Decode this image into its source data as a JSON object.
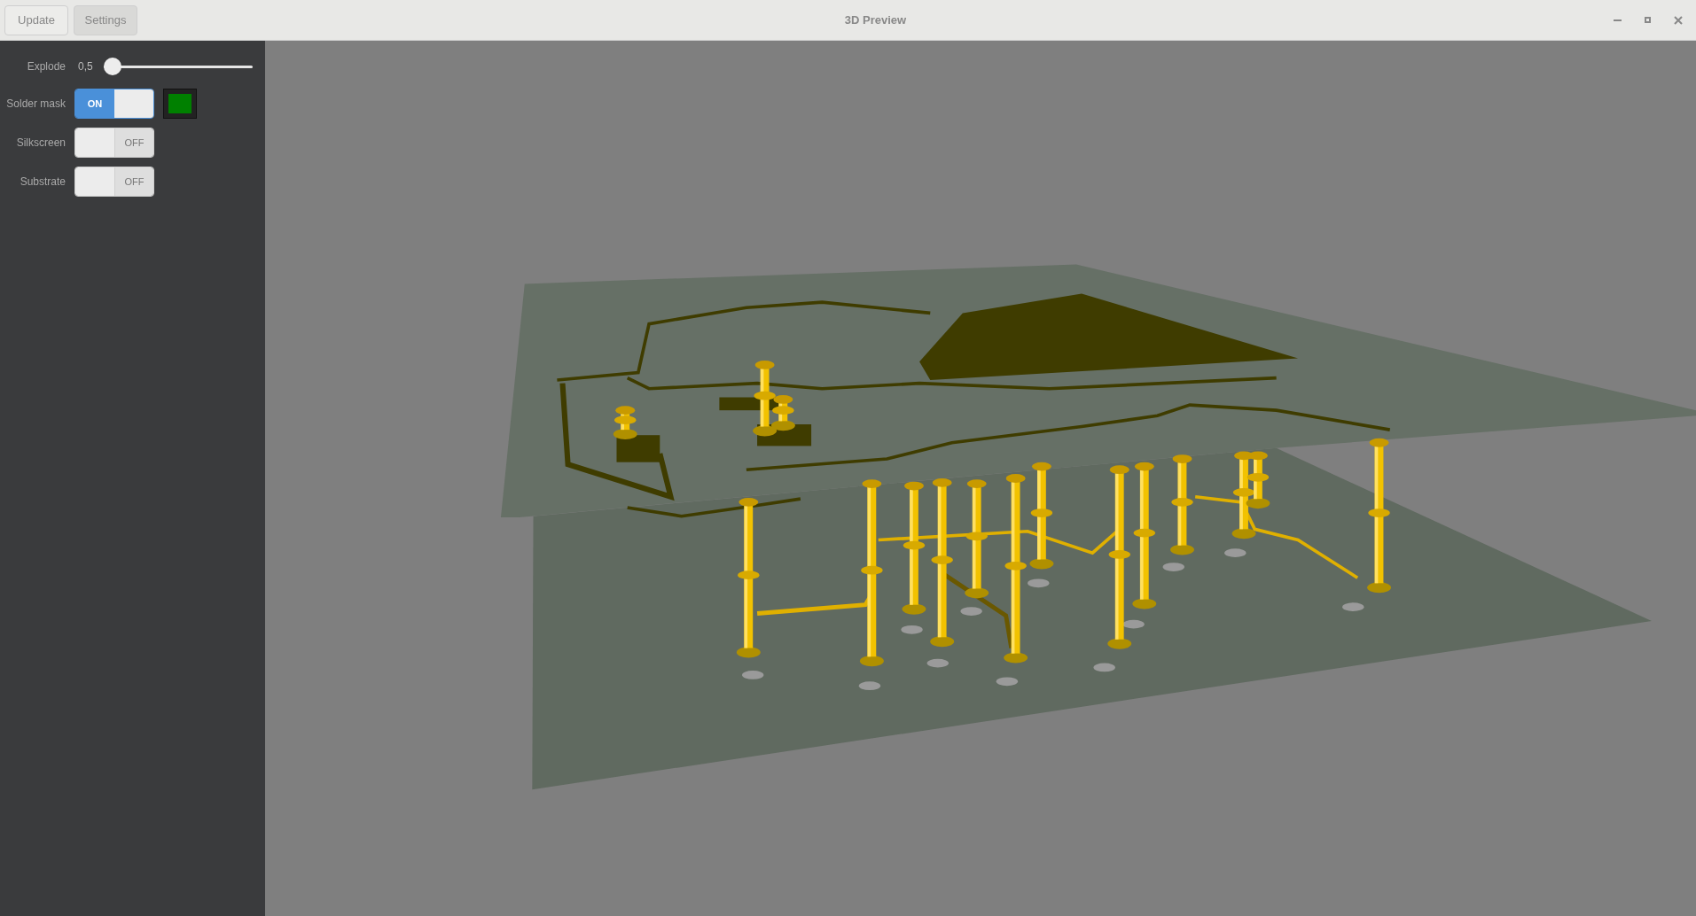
{
  "toolbar": {
    "buttons": [
      {
        "label": "Update",
        "selected": false
      },
      {
        "label": "Settings",
        "selected": true
      }
    ]
  },
  "window": {
    "title": "3D Preview"
  },
  "settings": {
    "explode": {
      "label": "Explode",
      "value": "0,5",
      "level": 0
    },
    "toggles": [
      {
        "label": "Solder mask",
        "on": true,
        "state_text": "ON",
        "color": "#008000"
      },
      {
        "label": "Silkscreen",
        "on": false,
        "state_text": "OFF"
      },
      {
        "label": "Substrate",
        "on": false,
        "state_text": "OFF"
      }
    ]
  }
}
